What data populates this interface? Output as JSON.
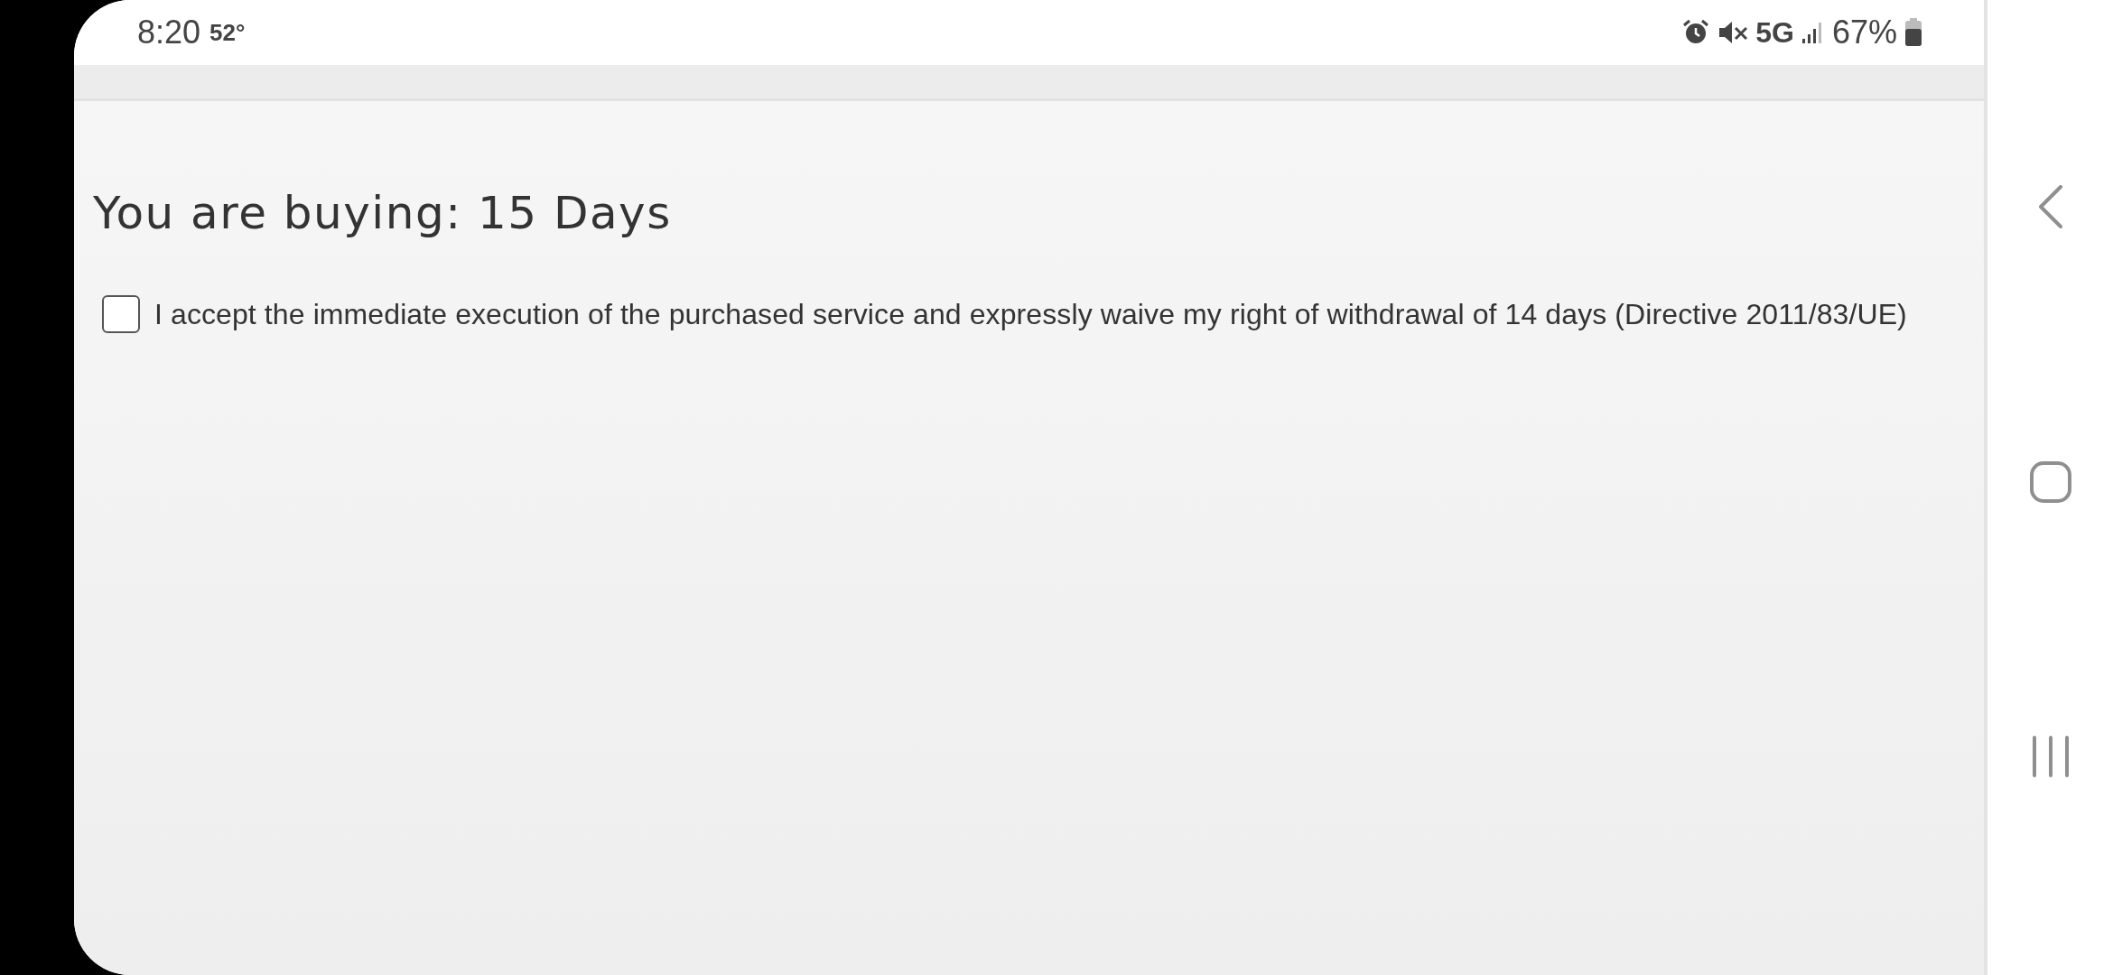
{
  "status_bar": {
    "time": "8:20",
    "temperature": "52°",
    "network": "5G",
    "battery": "67%"
  },
  "page": {
    "title": "You are buying: 15 Days",
    "consent": {
      "checked": false,
      "label": "I accept the immediate execution of the purchased service and expressly waive my right of withdrawal of 14 days (Directive 2011/83/UE)"
    }
  }
}
